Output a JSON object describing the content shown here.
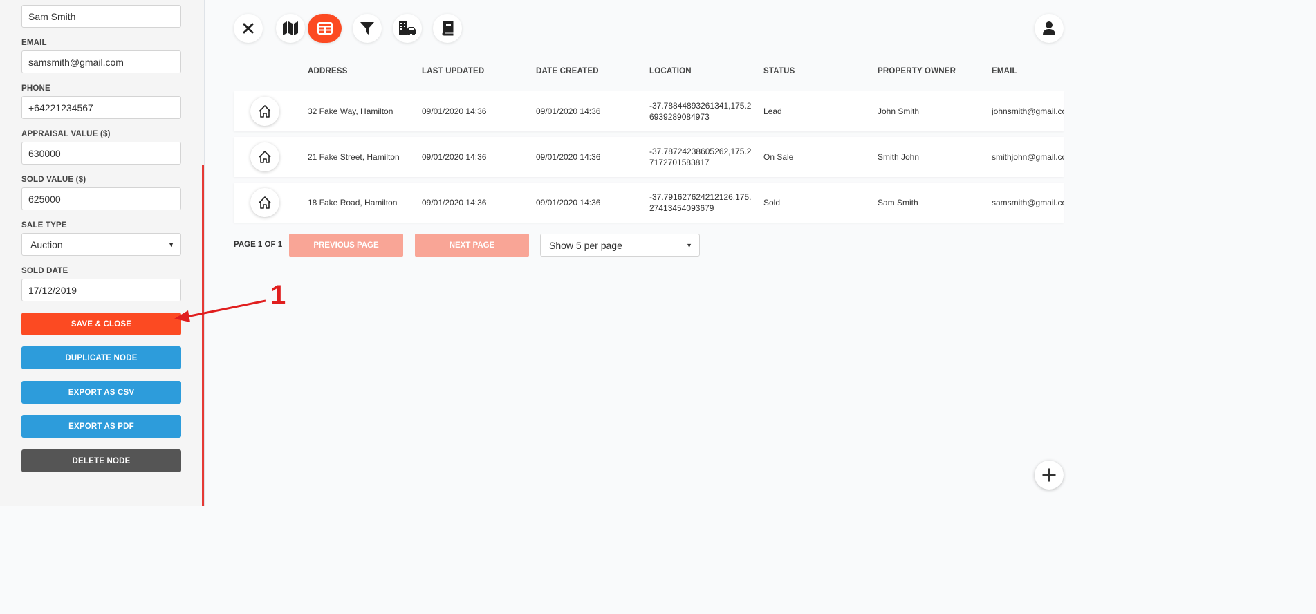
{
  "form": {
    "name_value": "Sam Smith",
    "email_label": "EMAIL",
    "email_value": "samsmith@gmail.com",
    "phone_label": "PHONE",
    "phone_value": "+64221234567",
    "appraisal_label": "APPRAISAL VALUE ($)",
    "appraisal_value": "630000",
    "sold_value_label": "SOLD VALUE ($)",
    "sold_value_value": "625000",
    "sale_type_label": "SALE TYPE",
    "sale_type_value": "Auction",
    "sold_date_label": "SOLD DATE",
    "sold_date_value": "17/12/2019"
  },
  "actions": {
    "save": "SAVE & CLOSE",
    "duplicate": "DUPLICATE NODE",
    "export_csv": "EXPORT AS CSV",
    "export_pdf": "EXPORT AS PDF",
    "delete": "DELETE NODE"
  },
  "annotation": {
    "number": "1",
    "color": "#e01e1e"
  },
  "toolbar": {
    "icons": [
      "close-icon",
      "map-icon",
      "table-icon",
      "filter-icon",
      "property-icon",
      "book-icon"
    ],
    "active": "table-icon",
    "accent": "#fc4a22"
  },
  "table": {
    "columns": [
      "ADDRESS",
      "LAST UPDATED",
      "DATE CREATED",
      "LOCATION",
      "STATUS",
      "PROPERTY OWNER",
      "EMAIL"
    ],
    "rows": [
      {
        "address": "32 Fake Way, Hamilton",
        "last_updated": "09/01/2020 14:36",
        "date_created": "09/01/2020 14:36",
        "location": "-37.78844893261341,175.26939289084973",
        "status": "Lead",
        "owner": "John Smith",
        "email": "johnsmith@gmail.com"
      },
      {
        "address": "21 Fake Street, Hamilton",
        "last_updated": "09/01/2020 14:36",
        "date_created": "09/01/2020 14:36",
        "location": "-37.78724238605262,175.27172701583817",
        "status": "On Sale",
        "owner": "Smith John",
        "email": "smithjohn@gmail.com"
      },
      {
        "address": "18 Fake Road, Hamilton",
        "last_updated": "09/01/2020 14:36",
        "date_created": "09/01/2020 14:36",
        "location": "-37.791627624212126,175.27413454093679",
        "status": "Sold",
        "owner": "Sam Smith",
        "email": "samsmith@gmail.com"
      }
    ]
  },
  "pagination": {
    "label": "PAGE 1 OF 1",
    "previous": "PREVIOUS PAGE",
    "next": "NEXT PAGE",
    "per_page": "Show 5 per page"
  }
}
